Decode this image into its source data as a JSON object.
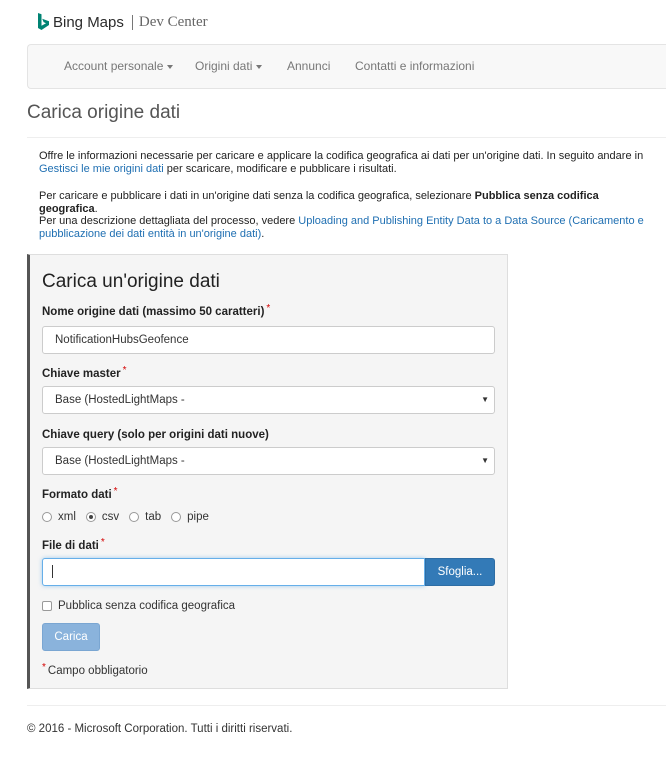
{
  "brand": {
    "name": "Bing Maps",
    "section": "Dev Center",
    "logo_color": "#008373"
  },
  "nav": {
    "items": [
      {
        "label": "Account personale",
        "dropdown": true
      },
      {
        "label": "Origini dati",
        "dropdown": true
      },
      {
        "label": "Annunci",
        "dropdown": false
      },
      {
        "label": "Contatti e informazioni",
        "dropdown": false
      }
    ]
  },
  "page": {
    "title": "Carica origine dati",
    "intro1_prefix": "Offre le informazioni necessarie per caricare e applicare la codifica geografica ai dati per un'origine dati. In seguito andare in ",
    "intro1_link": "Gestisci le mie origini dati",
    "intro1_suffix": " per scaricare, modificare e pubblicare i risultati.",
    "intro2_prefix": "Per caricare e pubblicare i dati in un'origine dati senza la codifica geografica, selezionare ",
    "intro2_bold": "Pubblica senza codifica geografica",
    "intro2_suffix": ".",
    "intro3_prefix": "Per una descrizione dettagliata del processo, vedere ",
    "intro3_link": "Uploading and Publishing Entity Data to a Data Source (Caricamento e pubblicazione dei dati entità in un'origine dati)",
    "intro3_suffix": "."
  },
  "form": {
    "title": "Carica un'origine dati",
    "name_label": "Nome origine dati (massimo 50 caratteri)",
    "name_value": "NotificationHubsGeofence",
    "master_key_label": "Chiave master",
    "master_key_value": "Base (HostedLightMaps -",
    "query_key_label": "Chiave query (solo per origini dati nuove)",
    "query_key_value": "Base (HostedLightMaps -",
    "format_label": "Formato dati",
    "formats": [
      "xml",
      "csv",
      "tab",
      "pipe"
    ],
    "selected_format": "csv",
    "file_label": "File di dati",
    "file_value": "",
    "browse_label": "Sfoglia...",
    "publish_label": "Pubblica senza codifica geografica",
    "publish_checked": false,
    "submit_label": "Carica",
    "required_note": "Campo obbligatorio",
    "required_mark": "*"
  },
  "footer": {
    "text": "© 2016 - Microsoft Corporation. Tutti i diritti riservati."
  },
  "colors": {
    "link": "#1f6fb2",
    "primary_button": "#337ab7",
    "disabled_button": "#8ab3dc",
    "required": "#d40000"
  }
}
